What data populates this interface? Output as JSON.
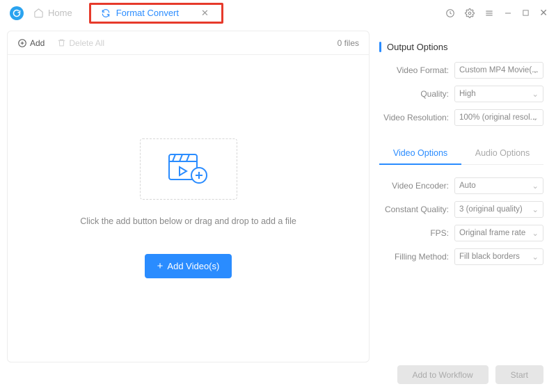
{
  "header": {
    "home_label": "Home",
    "tab_label": "Format Convert"
  },
  "toolbar": {
    "add_label": "Add",
    "delete_label": "Delete All",
    "filecount": "0 files"
  },
  "dropzone": {
    "hint": "Click the add button below or drag and drop to add a file",
    "button_label": "Add Video(s)"
  },
  "output": {
    "title": "Output Options",
    "video_format_label": "Video Format:",
    "video_format_value": "Custom MP4 Movie(...",
    "quality_label": "Quality:",
    "quality_value": "High",
    "resolution_label": "Video Resolution:",
    "resolution_value": "100% (original resol..."
  },
  "optabs": {
    "video": "Video Options",
    "audio": "Audio Options"
  },
  "video_options": {
    "encoder_label": "Video Encoder:",
    "encoder_value": "Auto",
    "cq_label": "Constant Quality:",
    "cq_value": "3 (original quality)",
    "fps_label": "FPS:",
    "fps_value": "Original frame rate",
    "fill_label": "Filling Method:",
    "fill_value": "Fill black borders"
  },
  "footer": {
    "workflow": "Add to Workflow",
    "start": "Start"
  }
}
